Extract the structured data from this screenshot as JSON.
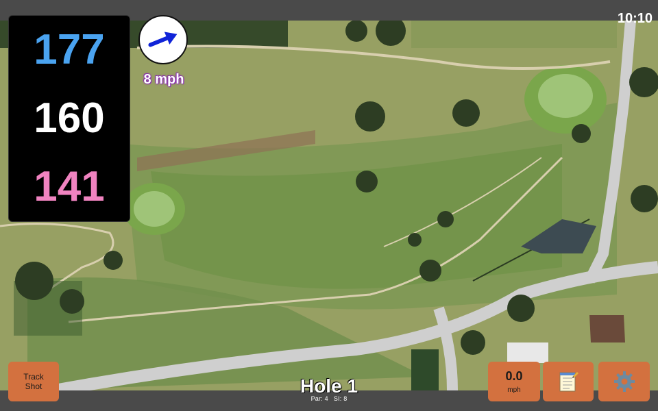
{
  "status_bar": {
    "time": "10:10"
  },
  "distances": {
    "back": "177",
    "middle": "160",
    "front": "141"
  },
  "wind": {
    "speed": "8 mph",
    "icon": "arrow-right-icon"
  },
  "buttons": {
    "track_shot": {
      "line1": "Track",
      "line2": "Shot"
    },
    "speed": {
      "value": "0.0",
      "unit": "mph"
    },
    "notes": {
      "icon": "notepad-icon"
    },
    "settings": {
      "icon": "gear-icon"
    }
  },
  "hole": {
    "title": "Hole 1",
    "par": "Par: 4",
    "si": "SI: 8"
  },
  "colors": {
    "back_distance": "#4aa3f0",
    "middle_distance": "#ffffff",
    "front_distance": "#f083c0",
    "button": "#d3713f",
    "bar": "#4a4a4a"
  }
}
